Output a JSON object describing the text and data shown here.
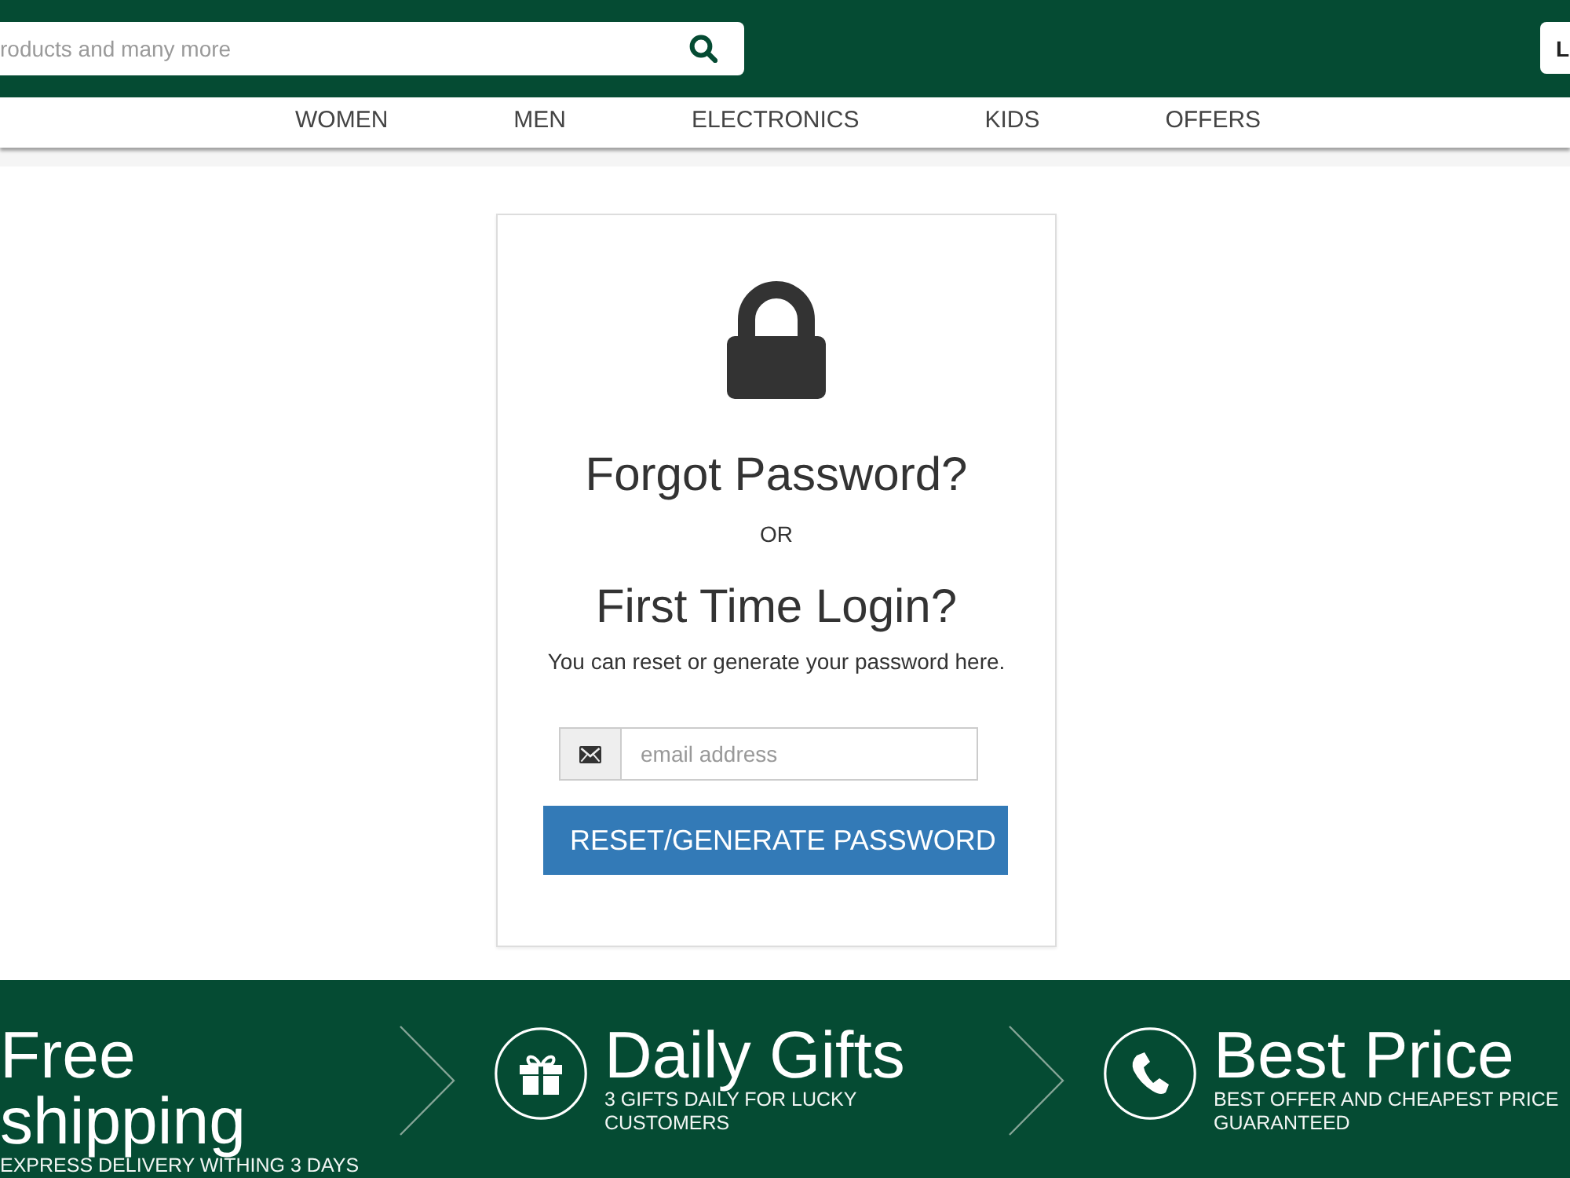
{
  "header": {
    "search": {
      "placeholder": "roducts and many more"
    },
    "header_button": "L"
  },
  "nav": {
    "items": [
      "WOMEN",
      "MEN",
      "ELECTRONICS",
      "KIDS",
      "OFFERS"
    ]
  },
  "reset_card": {
    "title": "Forgot Password?",
    "separator": "OR",
    "subtitle": "First Time Login?",
    "description": "You can reset or generate your password here.",
    "email_field": {
      "placeholder": "email address"
    },
    "submit_button": "RESET/GENERATE PASSWORD"
  },
  "features": [
    {
      "kind": "plain",
      "title": "Free shipping",
      "text": "EXPRESS DELIVERY WITHING 3 DAYS"
    },
    {
      "kind": "gift",
      "title": "Daily Gifts",
      "text": "3 GIFTS DAILY FOR LUCKY CUSTOMERS"
    },
    {
      "kind": "phone",
      "title": "Best Price",
      "text": "BEST OFFER AND CHEAPEST PRICE GUARANTEED"
    }
  ]
}
